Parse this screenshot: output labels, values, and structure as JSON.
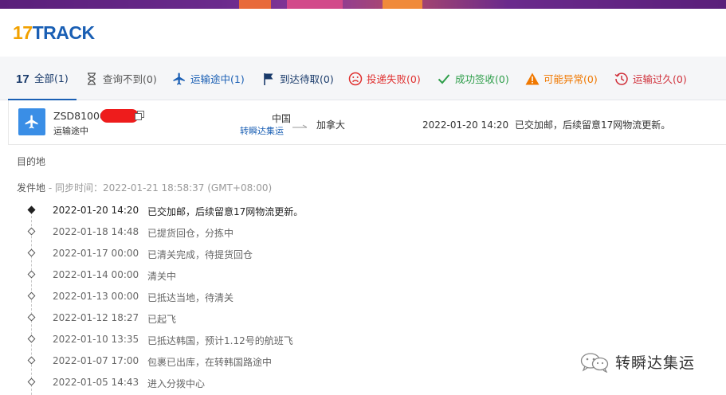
{
  "logo": {
    "num": "17",
    "text": "TRACK"
  },
  "tabs": [
    {
      "label": "全部(1)",
      "icon": "seventeen-icon",
      "color": "#1a3b6b",
      "active": true
    },
    {
      "label": "查询不到(0)",
      "icon": "hourglass-icon",
      "color": "#555555"
    },
    {
      "label": "运输途中(1)",
      "icon": "airplane-icon",
      "color": "#1a5fb4"
    },
    {
      "label": "到达待取(0)",
      "icon": "flag-icon",
      "color": "#1a3b6b"
    },
    {
      "label": "投递失败(0)",
      "icon": "sad-face-icon",
      "color": "#e0302f"
    },
    {
      "label": "成功签收(0)",
      "icon": "checkmark-icon",
      "color": "#2e9e4a"
    },
    {
      "label": "可能异常(0)",
      "icon": "warning-icon",
      "color": "#f07800"
    },
    {
      "label": "运输过久(0)",
      "icon": "history-icon",
      "color": "#d0303a"
    }
  ],
  "package": {
    "number": "ZSD81000",
    "status": "运输途中",
    "origin": "中国",
    "origin_carrier": "转瞬达集运",
    "destination": "加拿大",
    "latest_time": "2022-01-20 14:20",
    "latest_desc": "已交加邮，后续留意17网物流更新。"
  },
  "details": {
    "destination_label": "目的地",
    "origin_label": "发件地",
    "sync_text": " - 同步时间：2022-01-21 18:58:37 (GMT+08:00)"
  },
  "events": [
    {
      "time": "2022-01-20 14:20",
      "desc": "已交加邮，后续留意17网物流更新。"
    },
    {
      "time": "2022-01-18 14:48",
      "desc": "已提货回仓，分拣中"
    },
    {
      "time": "2022-01-17 00:00",
      "desc": "已清关完成，待提货回仓"
    },
    {
      "time": "2022-01-14 00:00",
      "desc": "清关中"
    },
    {
      "time": "2022-01-13 00:00",
      "desc": "已抵达当地，待清关"
    },
    {
      "time": "2022-01-12 18:27",
      "desc": "已起飞"
    },
    {
      "time": "2022-01-10 13:35",
      "desc": "已抵达韩国，预计1.12号的航班飞"
    },
    {
      "time": "2022-01-07 17:00",
      "desc": "包裹已出库，在转韩国路途中"
    },
    {
      "time": "2022-01-05 14:43",
      "desc": "进入分拨中心"
    }
  ],
  "watermark": {
    "text": "转瞬达集运"
  }
}
